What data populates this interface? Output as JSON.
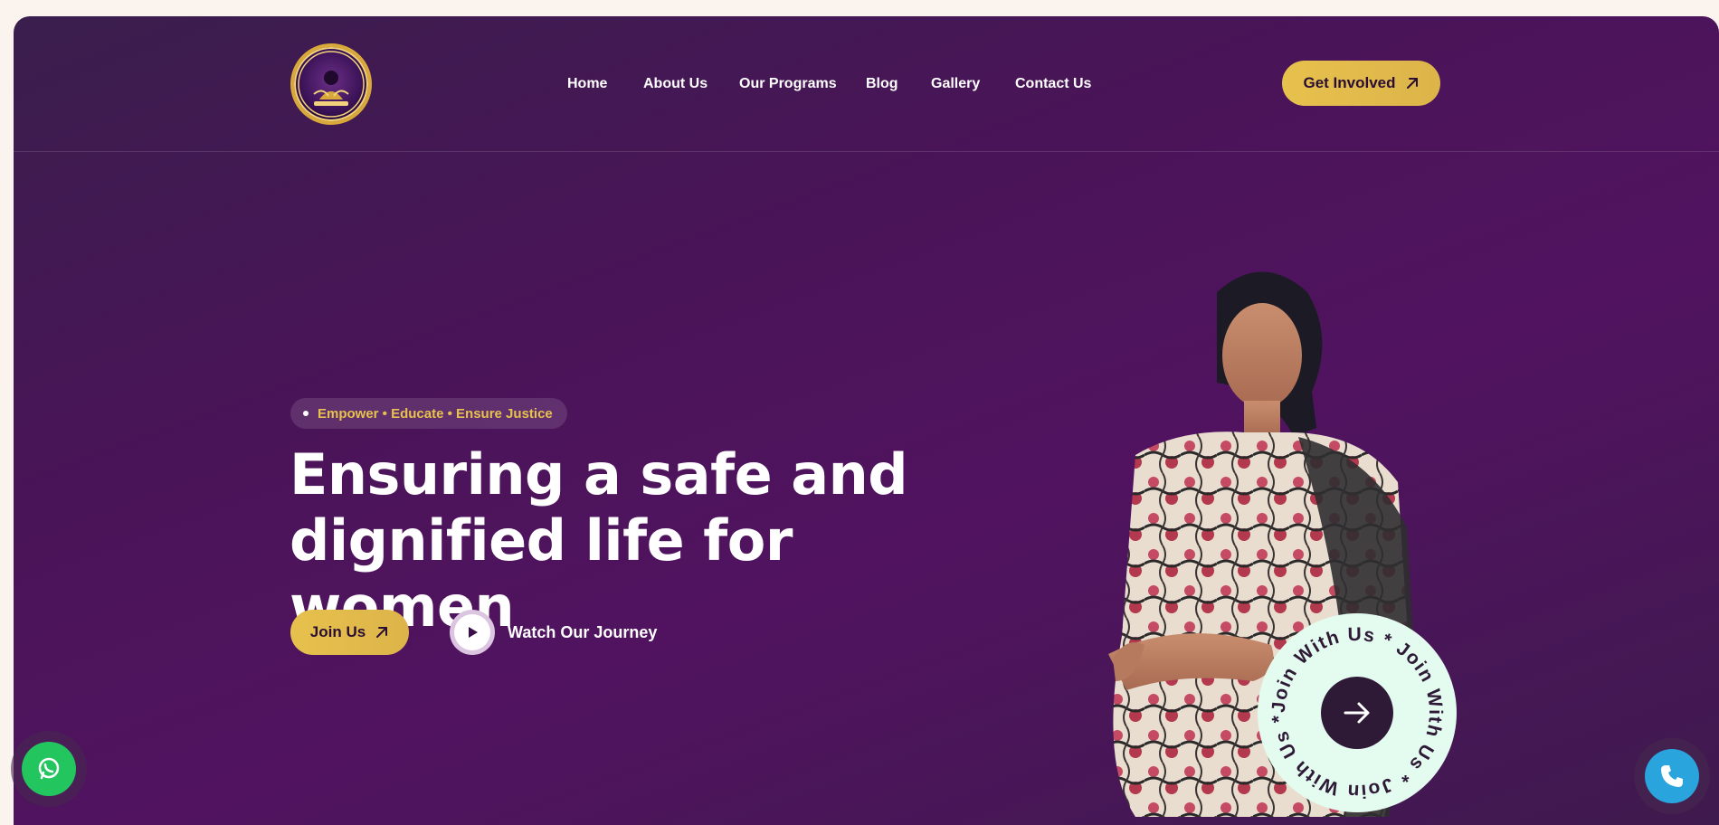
{
  "nav": {
    "items": [
      {
        "label": "Home"
      },
      {
        "label": "About Us"
      },
      {
        "label": "Our Programs"
      },
      {
        "label": "Blog"
      },
      {
        "label": "Gallery"
      },
      {
        "label": "Contact Us"
      }
    ],
    "cta_label": "Get Involved",
    "logo_icon": "organization-seal-logo"
  },
  "hero": {
    "tagline": "Empower • Educate • Ensure Justice",
    "headline": "Ensuring a safe and dignified life for women",
    "join_label": "Join Us",
    "watch_label": "Watch Our Journey",
    "badge_text": "Join With Us * Join With Us * Join With Us * ",
    "image": "woman-in-saree-photo"
  },
  "floating": {
    "whatsapp_icon": "whatsapp-icon",
    "call_icon": "phone-icon"
  },
  "colors": {
    "background": "#4a1458",
    "accent_gold": "#e7c14d",
    "badge_mint": "#e4fbef",
    "whatsapp_green": "#23c55e",
    "call_blue": "#2aa4dd"
  }
}
